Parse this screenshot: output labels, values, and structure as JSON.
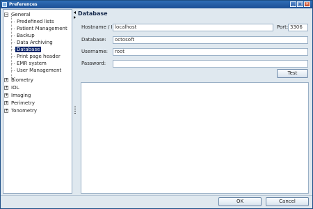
{
  "window": {
    "title": "Preferences"
  },
  "tree": {
    "general": {
      "label": "General",
      "children": [
        {
          "label": "Predefined lists"
        },
        {
          "label": "Patient Management"
        },
        {
          "label": "Backup"
        },
        {
          "label": "Data Archiving"
        },
        {
          "label": "Database",
          "selected": true
        },
        {
          "label": "Print page header"
        },
        {
          "label": "EMR system"
        },
        {
          "label": "User Management"
        }
      ]
    },
    "others": [
      {
        "label": "Biometry"
      },
      {
        "label": "IOL"
      },
      {
        "label": "Imaging"
      },
      {
        "label": "Perimetry"
      },
      {
        "label": "Tonometry"
      }
    ]
  },
  "panel": {
    "heading": "Database",
    "hostname_label": "Hostname / IP:",
    "hostname_value": "localhost",
    "port_label": "Port:",
    "port_value": "3306",
    "database_label": "Database:",
    "database_value": "octosoft",
    "username_label": "Username:",
    "username_value": "root",
    "password_label": "Password:",
    "password_value": "",
    "test_button": "Test"
  },
  "footer": {
    "ok_label": "OK",
    "cancel_label": "Cancel"
  },
  "colors": {
    "titlebar": "#1c4f94",
    "selection": "#0a246a",
    "window_bg": "#dfe8ef"
  }
}
